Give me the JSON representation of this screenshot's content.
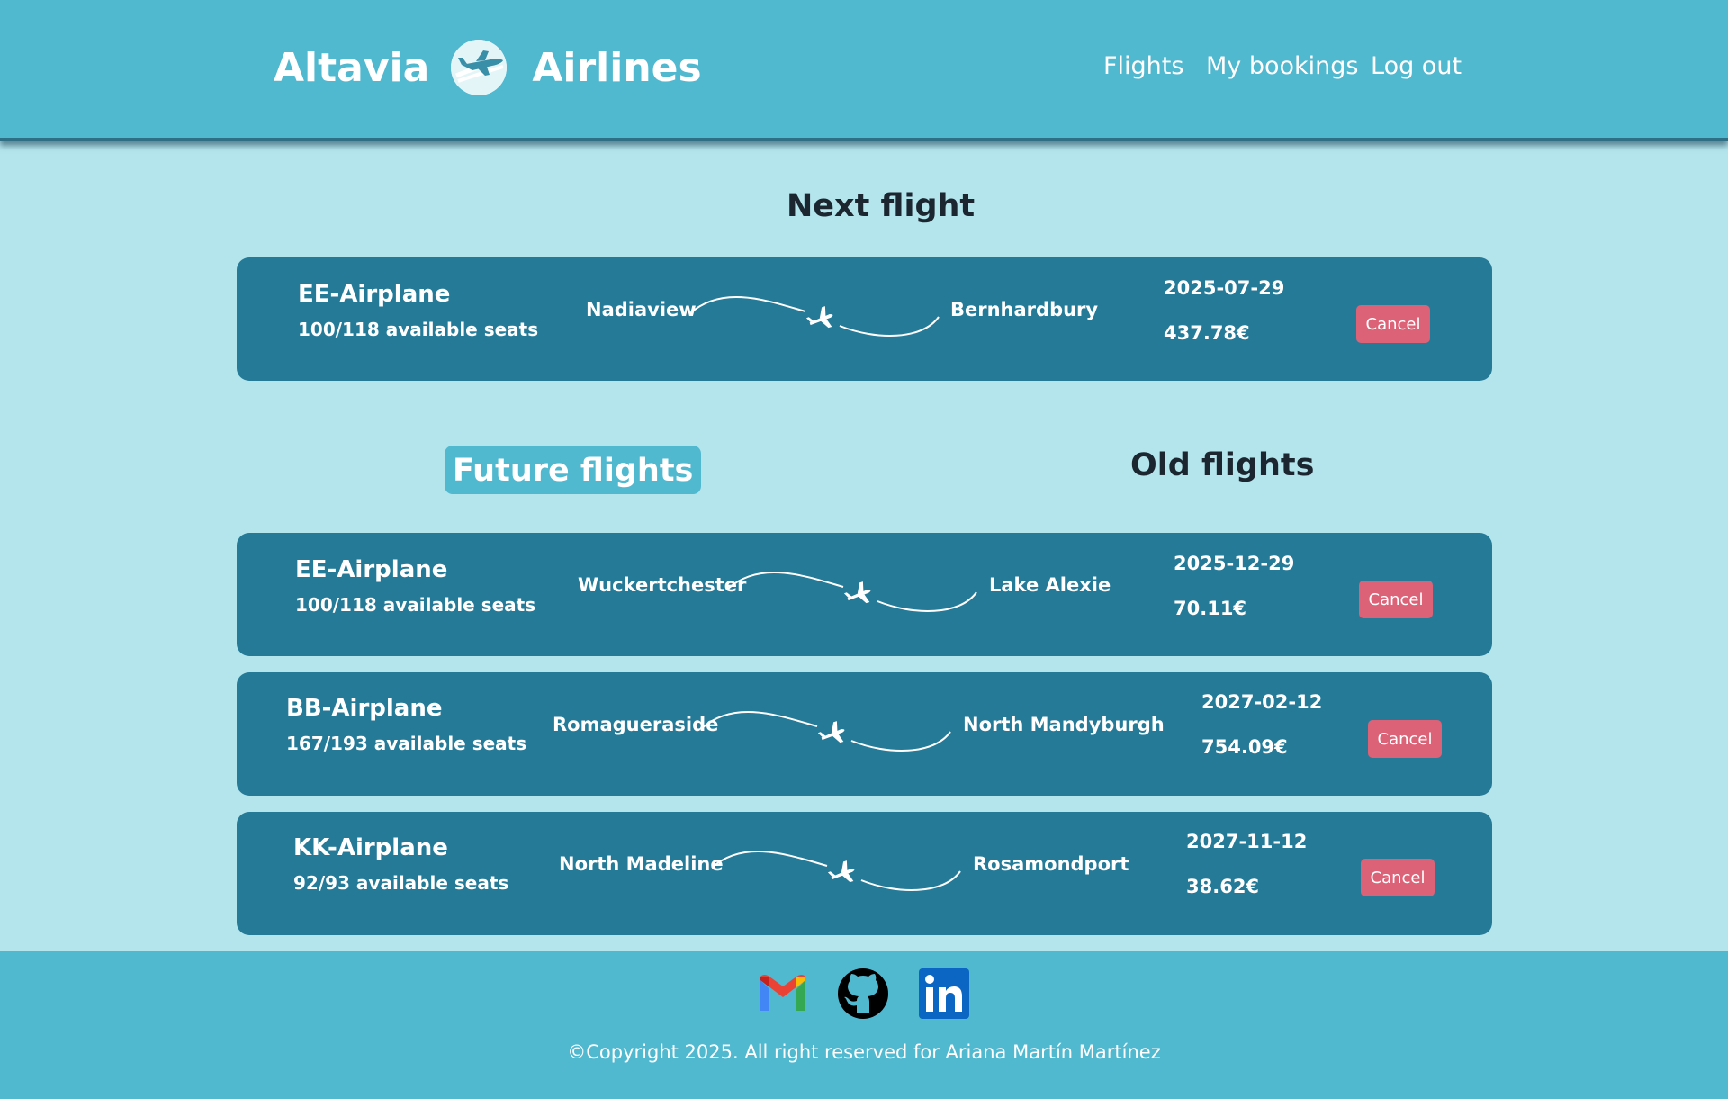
{
  "header": {
    "brand_left": "Altavia",
    "brand_right": "Airlines",
    "logo_icon": "airplane-logo-icon",
    "nav": {
      "flights": "Flights",
      "my_bookings": "My bookings",
      "log_out": "Log out"
    }
  },
  "next_flight": {
    "title": "Next flight",
    "flight": {
      "plane": "EE-Airplane",
      "seats": "100/118 available seats",
      "origin": "Nadiaview",
      "destination": "Bernhardbury",
      "date": "2025-07-29",
      "price": "437.78€",
      "cancel_label": "Cancel"
    }
  },
  "tabs": {
    "future": "Future flights",
    "old": "Old flights",
    "active": "future"
  },
  "future_flights": [
    {
      "plane": "EE-Airplane",
      "seats": "100/118 available seats",
      "origin": "Wuckertchester",
      "destination": "Lake Alexie",
      "date": "2025-12-29",
      "price": "70.11€",
      "cancel_label": "Cancel"
    },
    {
      "plane": "BB-Airplane",
      "seats": "167/193 available seats",
      "origin": "Romagueraside",
      "destination": "North Mandyburgh",
      "date": "2027-02-12",
      "price": "754.09€",
      "cancel_label": "Cancel"
    },
    {
      "plane": "KK-Airplane",
      "seats": "92/93 available seats",
      "origin": "North Madeline",
      "destination": "Rosamondport",
      "date": "2027-11-12",
      "price": "38.62€",
      "cancel_label": "Cancel"
    }
  ],
  "footer": {
    "social": [
      "gmail-icon",
      "github-icon",
      "linkedin-icon"
    ],
    "copyright": "©Copyright 2025. All right reserved for Ariana Martín Martínez"
  },
  "colors": {
    "header_bg": "#50b8cf",
    "page_bg": "#b4e4ec",
    "card_bg": "#247a97",
    "cancel_bg": "#dc6277"
  }
}
